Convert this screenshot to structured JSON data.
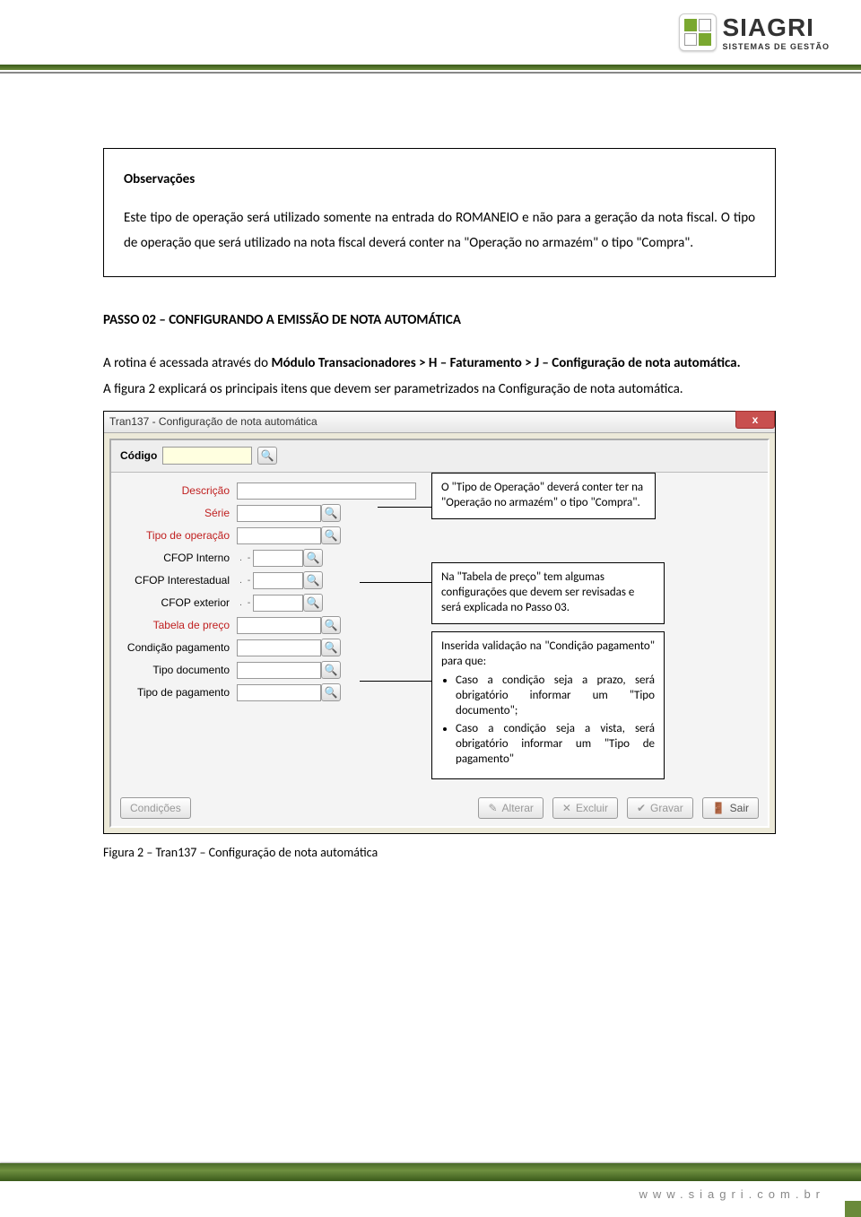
{
  "header": {
    "brand_name": "SIAGRI",
    "brand_sub": "SISTEMAS DE GESTÃO"
  },
  "obs": {
    "title": "Observações",
    "p1": "Este tipo de operação será utilizado somente na entrada do ROMANEIO e não para a geração da nota fiscal. O tipo de operação que será utilizado na nota fiscal deverá conter na \"Operação no armazém\" o tipo \"Compra\"."
  },
  "passo": {
    "title": "PASSO 02 – CONFIGURANDO A EMISSÃO DE NOTA AUTOMÁTICA",
    "p_pre": "A rotina é acessada através do ",
    "p_bold": "Módulo Transacionadores > H – Faturamento > J – Configuração de nota automática.",
    "p2": "A figura 2 explicará os principais itens que devem ser parametrizados na Configuração de nota automática."
  },
  "dialog": {
    "title": "Tran137 - Configuração de nota automática",
    "close": "x",
    "codigo_label": "Código",
    "fields": {
      "descricao": "Descrição",
      "serie": "Série",
      "tipo_op": "Tipo de operação",
      "cfop_int": "CFOP Interno",
      "cfop_ie": "CFOP Interestadual",
      "cfop_ext": "CFOP exterior",
      "tabela": "Tabela de preço",
      "cond": "Condição pagamento",
      "tipo_doc": "Tipo documento",
      "tipo_pag": "Tipo de pagamento"
    },
    "buttons": {
      "cond": "Condições",
      "alterar": "Alterar",
      "excluir": "Excluir",
      "gravar": "Gravar",
      "sair": "Sair"
    }
  },
  "callouts": {
    "c1": "O \"Tipo de Operação\" deverá conter ter na \"Operação no armazém\" o tipo \"Compra\".",
    "c2": "Na \"Tabela de preço\" tem algumas configurações que devem ser revisadas e será explicada no Passo 03.",
    "c3_head": "Inserida validação na \"Condição pagamento\" para que:",
    "c3_li1": "Caso a condição seja a prazo, será obrigatório informar um \"Tipo documento\";",
    "c3_li2": "Caso a condição seja a vista, será obrigatório informar um \"Tipo de pagamento\""
  },
  "caption": "Figura 2 – Tran137 – Configuração de nota automática",
  "footer": {
    "url": "www.siagri.com.br"
  }
}
